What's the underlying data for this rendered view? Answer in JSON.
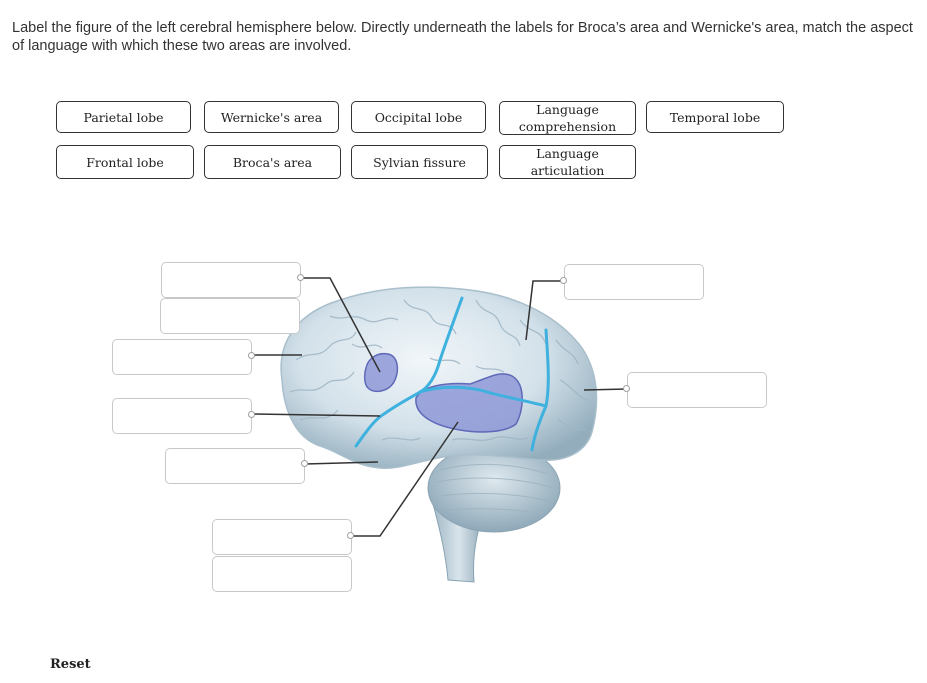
{
  "instructions": "Label the figure of the left cerebral hemisphere below. Directly underneath the labels for Broca’s area and Wernicke's area, match the aspect of language with which these two areas are involved.",
  "label_bank": [
    {
      "id": "parietal-lobe",
      "text": "Parietal lobe"
    },
    {
      "id": "wernickes-area",
      "text": "Wernicke's area"
    },
    {
      "id": "occipital-lobe",
      "text": "Occipital lobe"
    },
    {
      "id": "language-comprehension",
      "text": "Language comprehension"
    },
    {
      "id": "temporal-lobe",
      "text": "Temporal lobe"
    },
    {
      "id": "frontal-lobe",
      "text": "Frontal lobe"
    },
    {
      "id": "brocas-area",
      "text": "Broca's area"
    },
    {
      "id": "sylvian-fissure",
      "text": "Sylvian fissure"
    },
    {
      "id": "language-articulation",
      "text": "Language articulation"
    }
  ],
  "drop_zones": [
    {
      "id": "zone-1",
      "value": "",
      "sub_value": ""
    },
    {
      "id": "zone-2",
      "value": ""
    },
    {
      "id": "zone-3",
      "value": ""
    },
    {
      "id": "zone-4",
      "value": ""
    },
    {
      "id": "zone-5",
      "value": "",
      "sub_value": ""
    },
    {
      "id": "zone-6",
      "value": ""
    },
    {
      "id": "zone-7",
      "value": ""
    }
  ],
  "colors": {
    "fissure_line": "#3fb1de",
    "highlight_area": "#8a93d6",
    "brain_base": "#d6e3ec",
    "leader_line": "#333333"
  },
  "reset_label": "Reset"
}
